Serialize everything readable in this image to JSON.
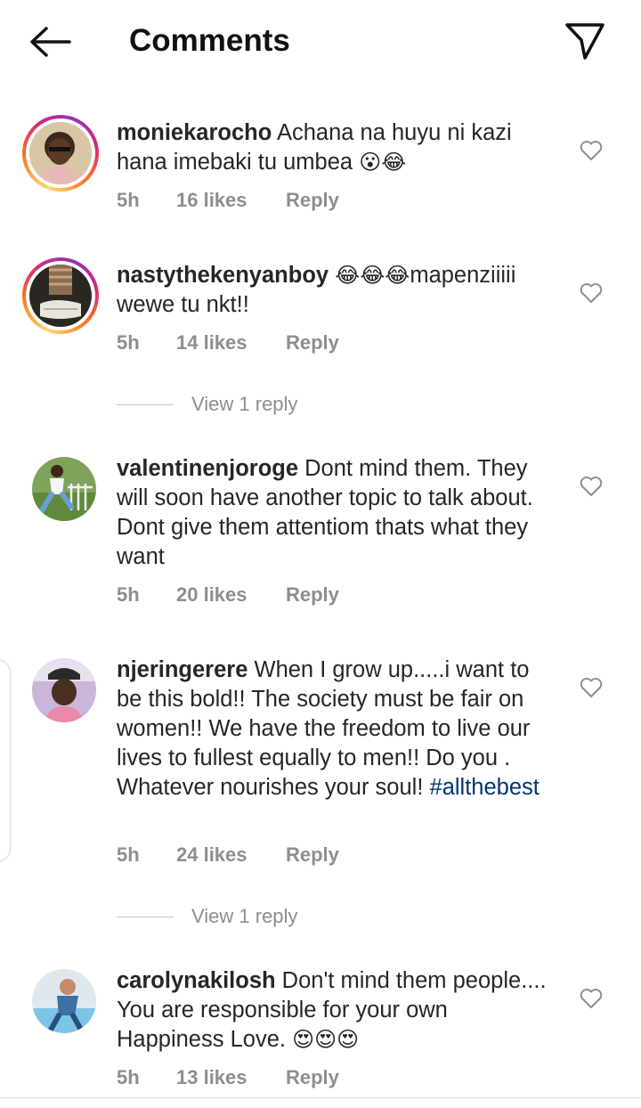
{
  "header": {
    "title": "Comments",
    "back_icon": "arrow-left-icon",
    "send_icon": "paper-plane-icon"
  },
  "comments": [
    {
      "username": "moniekarocho",
      "text": "Achana na huyu ni kazi hana imebaki tu umbea",
      "emojis": "😮😂",
      "time": "5h",
      "likes": "16 likes",
      "reply": "Reply",
      "story_ring": true
    },
    {
      "username": "nastythekenyanboy",
      "text": "mapenziiiii wewe tu nkt!!",
      "emojis": "😂😂😂",
      "time": "5h",
      "likes": "14 likes",
      "reply": "Reply",
      "story_ring": true,
      "view_replies": "View 1 reply"
    },
    {
      "username": "valentinenjoroge",
      "text": "Dont mind them. They will soon have another topic to talk about. Dont give them attentiom thats what they want",
      "time": "5h",
      "likes": "20 likes",
      "reply": "Reply",
      "story_ring": false
    },
    {
      "username": "njeringerere",
      "text": "When I grow up.....i want to be this bold!! The society must be fair on women!! We have the freedom to live our lives to fullest equally to men!! Do you .  Whatever nourishes your soul!",
      "hashtag": "#allthebest",
      "time": "5h",
      "likes": "24 likes",
      "reply": "Reply",
      "story_ring": false,
      "view_replies": "View 1 reply"
    },
    {
      "username": "carolynakilosh",
      "text": "Don't mind them people.... You are responsible for your own Happiness Love.",
      "emojis": "😍😍😍",
      "time": "5h",
      "likes": "13 likes",
      "reply": "Reply",
      "story_ring": false
    }
  ],
  "colors": {
    "text": "#262626",
    "meta": "#8e8e8e",
    "hashtag": "#00376b",
    "ring": [
      "#feda75",
      "#fa7e1e",
      "#d62976",
      "#962fbf"
    ]
  }
}
